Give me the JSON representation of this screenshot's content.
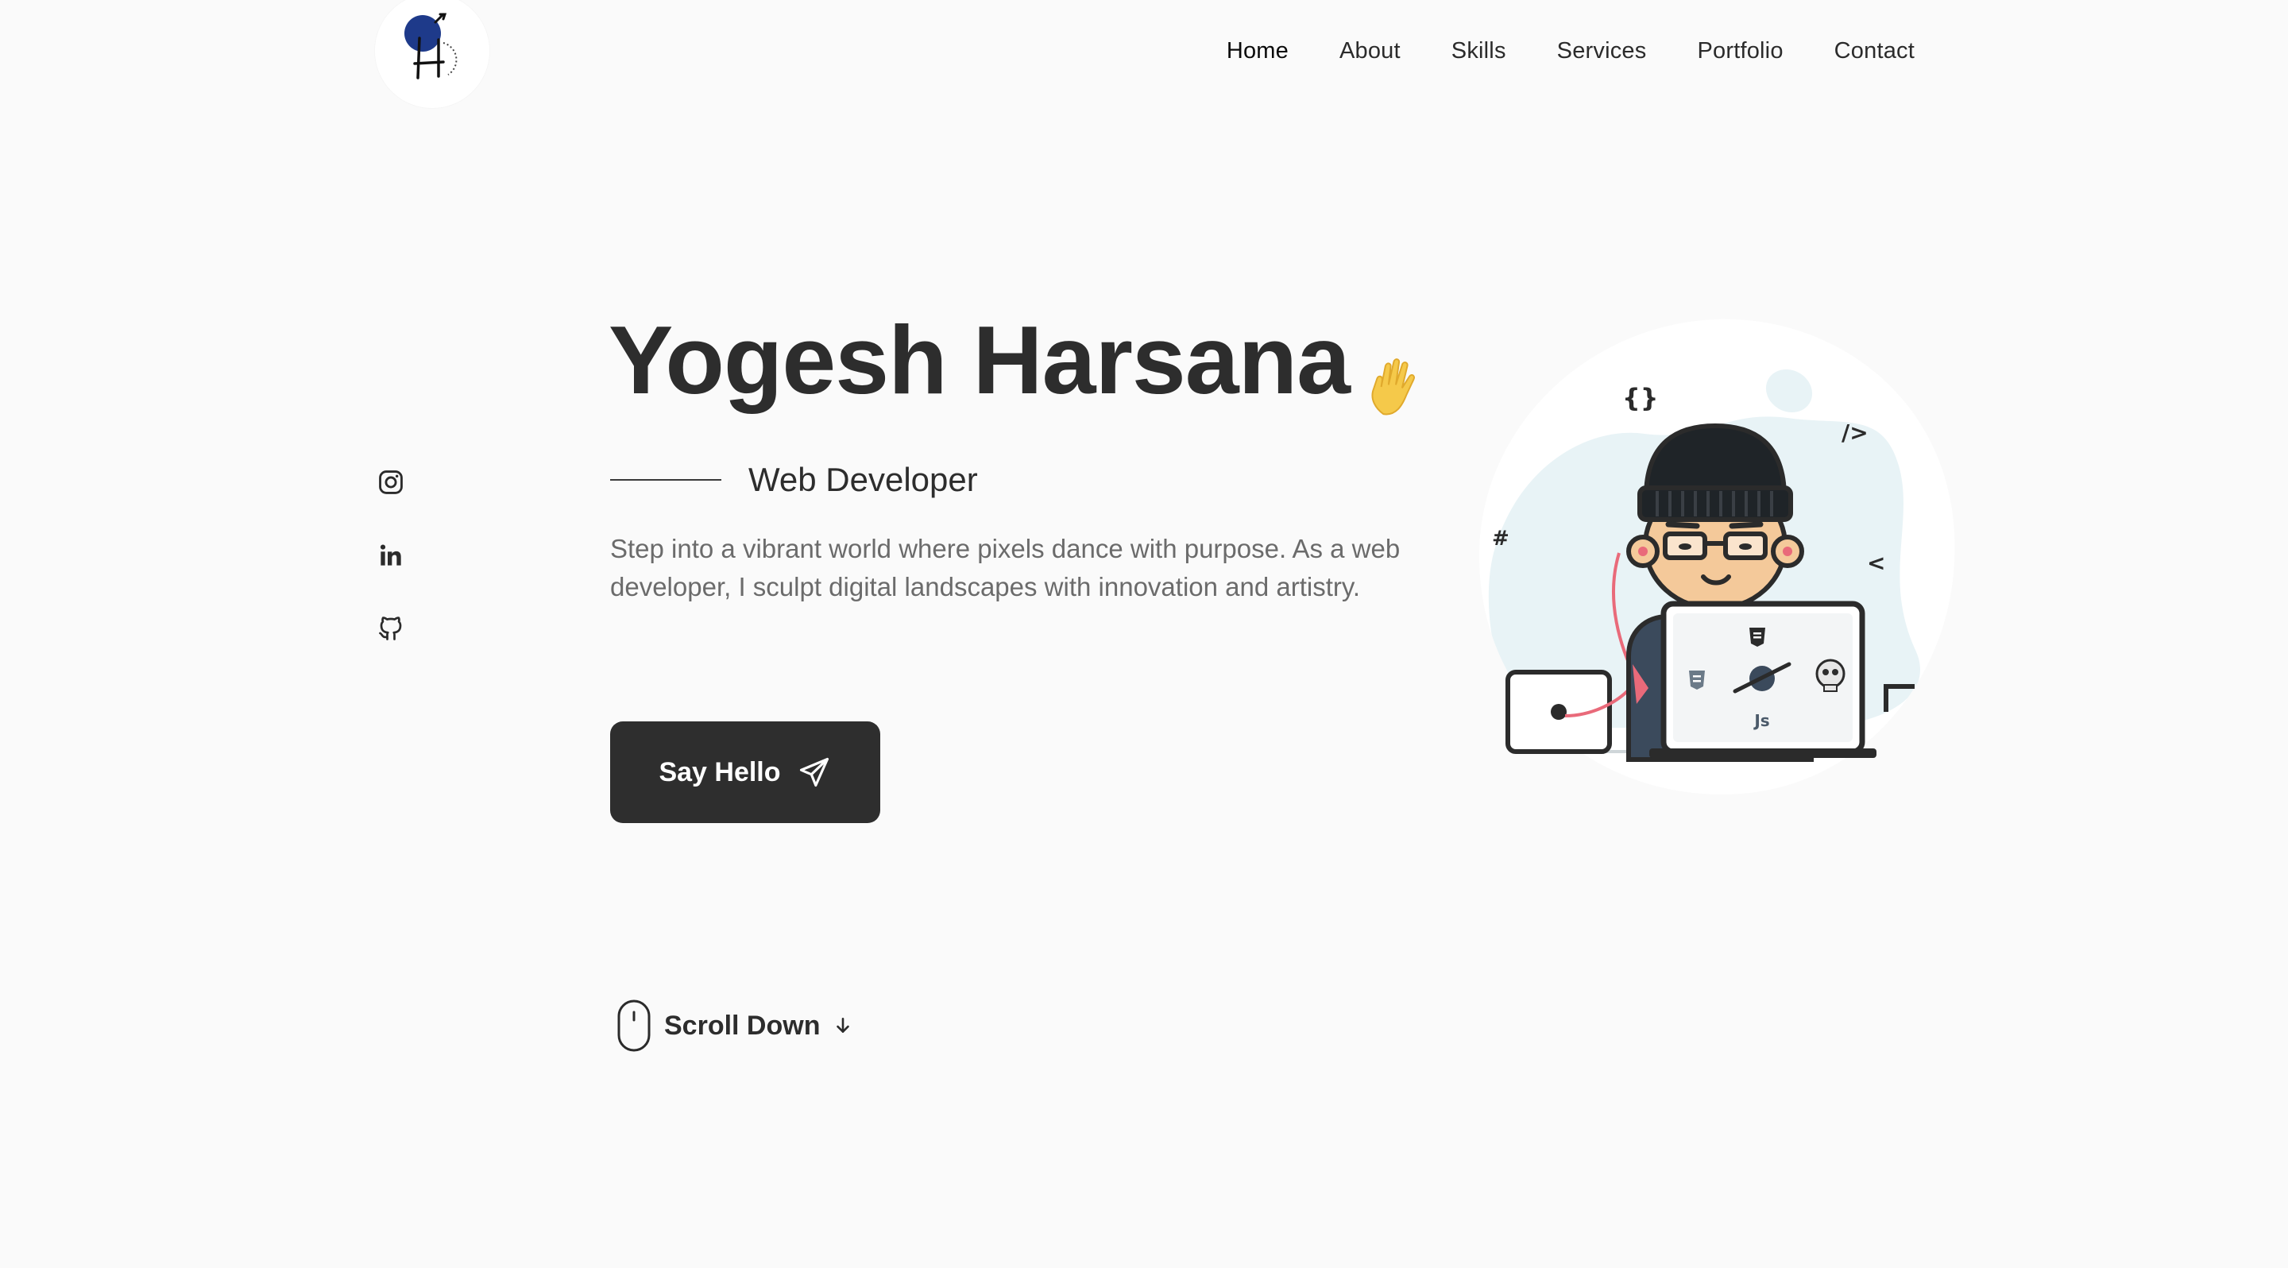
{
  "header": {
    "logo_icon": "yh-monogram-logo",
    "nav": [
      {
        "label": "Home",
        "active": true
      },
      {
        "label": "About",
        "active": false
      },
      {
        "label": "Skills",
        "active": false
      },
      {
        "label": "Services",
        "active": false
      },
      {
        "label": "Portfolio",
        "active": false
      },
      {
        "label": "Contact",
        "active": false
      }
    ]
  },
  "social": [
    {
      "icon": "instagram-icon"
    },
    {
      "icon": "linkedin-icon"
    },
    {
      "icon": "github-icon"
    }
  ],
  "hero": {
    "name": "Yogesh Harsana",
    "wave_icon": "waving-hand-icon",
    "role": "Web Developer",
    "description": "Step into a vibrant world where pixels dance with purpose. As a web developer, I sculpt digital landscapes with innovation and artistry.",
    "cta_label": "Say Hello",
    "cta_icon": "send-icon",
    "scroll_label": "Scroll Down",
    "scroll_icons": [
      "mouse-icon",
      "arrow-down-icon"
    ]
  },
  "illustration": {
    "description_icon": "developer-avatar-illustration",
    "laptop_badges": [
      "Js"
    ]
  },
  "colors": {
    "background": "#fafafa",
    "text_dark": "#2d2d2d",
    "text_muted": "#6b6b6b",
    "button_bg": "#2e2e2e",
    "logo_blue": "#1e3a8a",
    "blob": "#e8f3f6"
  }
}
